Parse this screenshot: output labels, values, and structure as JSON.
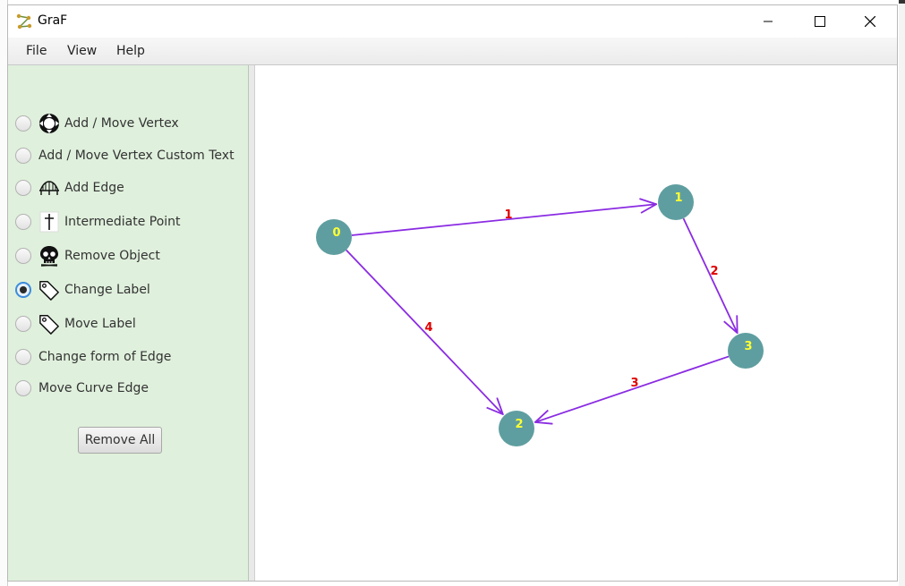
{
  "window": {
    "title": "GraF"
  },
  "menu": {
    "file": "File",
    "view": "View",
    "help": "Help"
  },
  "tools": {
    "add_move_vertex": "Add / Move Vertex",
    "add_move_vertex_custom": "Add / Move Vertex Custom Text",
    "add_edge": "Add Edge",
    "intermediate_point": "Intermediate Point",
    "remove_object": "Remove Object",
    "change_label": "Change Label",
    "move_label": "Move Label",
    "change_form_edge": "Change form of Edge",
    "move_curve_edge": "Move Curve Edge",
    "selected": "change_label"
  },
  "buttons": {
    "remove_all": "Remove All"
  },
  "graph": {
    "vertex_color": "#5f9ea0",
    "edge_color": "#8a2be2",
    "vertex_label_color": "#ffff33",
    "edge_label_color": "#e00000",
    "vertices": [
      {
        "id": "v0",
        "label": "0"
      },
      {
        "id": "v1",
        "label": "1"
      },
      {
        "id": "v2",
        "label": "2"
      },
      {
        "id": "v3",
        "label": "3"
      }
    ],
    "edges": [
      {
        "from": "0",
        "to": "1",
        "label": "1"
      },
      {
        "from": "1",
        "to": "3",
        "label": "2"
      },
      {
        "from": "3",
        "to": "2",
        "label": "3"
      },
      {
        "from": "0",
        "to": "2",
        "label": "4"
      }
    ]
  }
}
